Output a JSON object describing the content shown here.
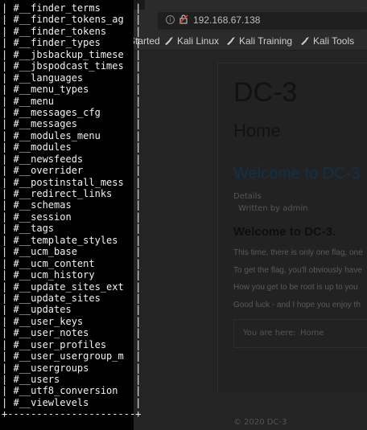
{
  "browser": {
    "url": "192.168.67.138",
    "bookmarks": [
      "Getting Started",
      "Kali Linux",
      "Kali Training",
      "Kali Tools"
    ]
  },
  "page": {
    "site_title": "DC-3",
    "page_title": "Home",
    "article_title": "Welcome to DC-3",
    "details_label": "Details",
    "written_by": "Written by admin",
    "welcome_heading": "Welcome to DC-3.",
    "paragraphs": [
      "This time, there is only one flag, one",
      "To get the flag, you'll obviously have",
      "How you get to be root is up to you",
      "Good luck - and I hope you enjoy th"
    ],
    "breadcrumb_label": "You are here:",
    "breadcrumb_home": "Home",
    "footer": "© 2020 DC-3"
  },
  "terminal": {
    "lines": [
      "| #__finder_terms      |",
      "| #__finder_tokens_ag  |",
      "| #__finder_tokens     |",
      "| #__finder_types      |",
      "| #__jbsbackup_timese  |",
      "| #__jbspodcast_times  |",
      "| #__languages         |",
      "| #__menu_types        |",
      "| #__menu              |",
      "| #__messages_cfg      |",
      "| #__messages          |",
      "| #__modules_menu      |",
      "| #__modules           |",
      "| #__newsfeeds         |",
      "| #__overrider         |",
      "| #__postinstall_mess  |",
      "| #__redirect_links    |",
      "| #__schemas           |",
      "| #__session           |",
      "| #__tags              |",
      "| #__template_styles   |",
      "| #__ucm_base          |",
      "| #__ucm_content       |",
      "| #__ucm_history       |",
      "| #__update_sites_ext  |",
      "| #__update_sites      |",
      "| #__updates           |",
      "| #__user_keys         |",
      "| #__user_notes        |",
      "| #__user_profiles     |",
      "| #__user_usergroup_m  |",
      "| #__usergroups        |",
      "| #__users             |",
      "| #__utf8_conversion   |",
      "| #__viewlevels        |",
      "+----------------------+"
    ]
  }
}
